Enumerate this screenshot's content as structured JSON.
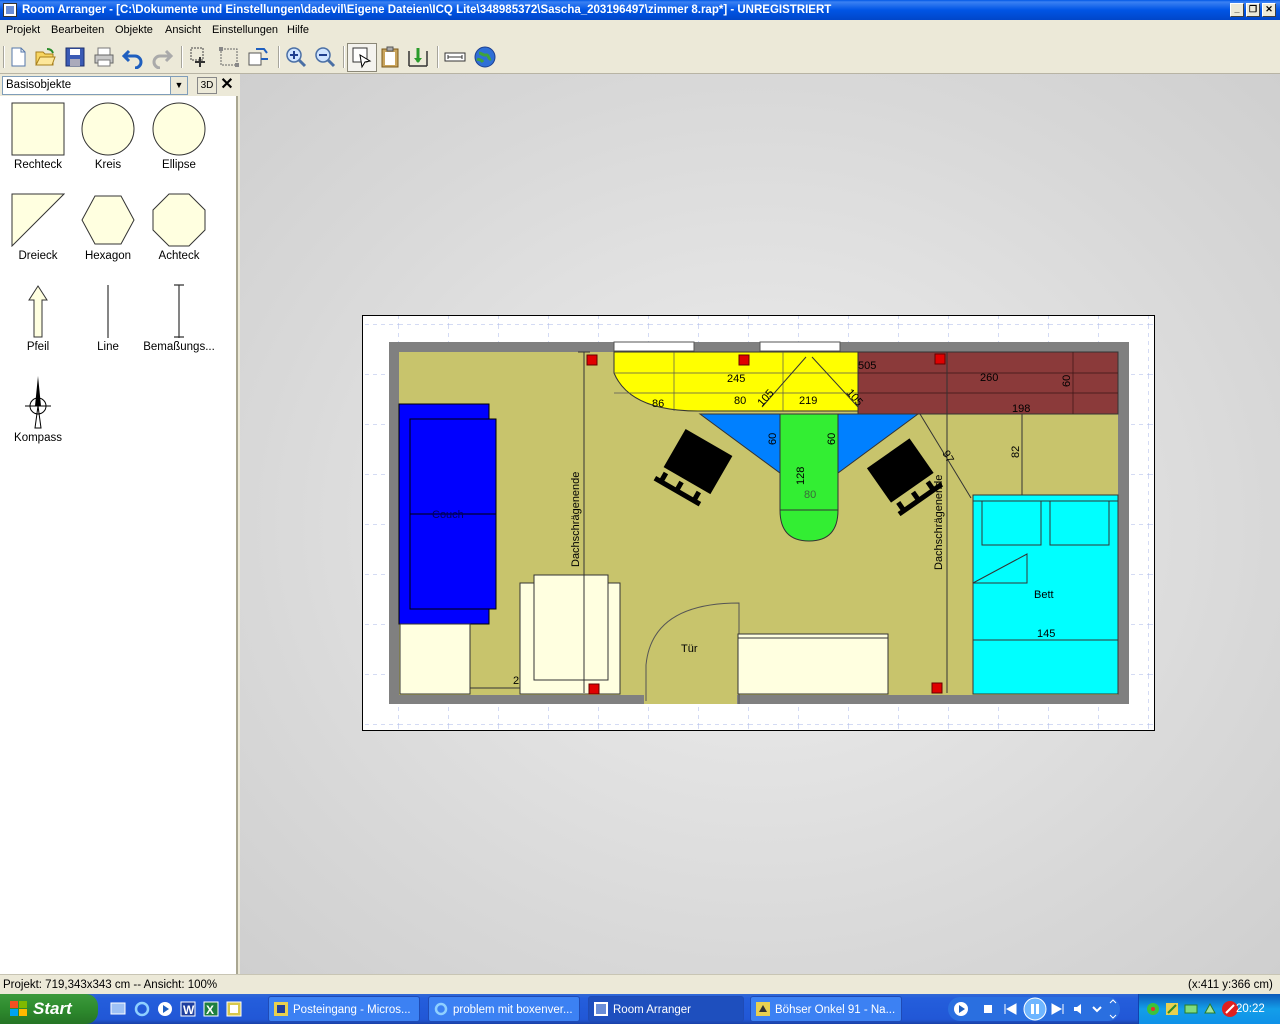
{
  "window": {
    "title": "Room Arranger - [C:\\Dokumente und Einstellungen\\dadevil\\Eigene Dateien\\ICQ Lite\\348985372\\Sascha_203196497\\zimmer 8.rap*] - UNREGISTRIERT"
  },
  "menu": [
    "Projekt",
    "Bearbeiten",
    "Objekte",
    "Ansicht",
    "Einstellungen",
    "Hilfe"
  ],
  "toolbar": {
    "icons": [
      "new-icon",
      "open-icon",
      "save-icon",
      "print-icon",
      "undo-icon",
      "redo-icon",
      "move-icon",
      "resize-icon",
      "rotate-icon",
      "zoom-in-icon",
      "zoom-out-icon",
      "select-icon",
      "clipboard-icon",
      "walls-icon",
      "dimension-icon",
      "globe-icon"
    ]
  },
  "panel": {
    "combo_value": "Basisobjekte",
    "btn_3d": "3D",
    "close": "✕",
    "shapes": [
      {
        "label": "Rechteck",
        "icon": "rectangle-icon"
      },
      {
        "label": "Kreis",
        "icon": "circle-icon"
      },
      {
        "label": "Ellipse",
        "icon": "ellipse-icon"
      },
      {
        "label": "Dreieck",
        "icon": "triangle-icon"
      },
      {
        "label": "Hexagon",
        "icon": "hexagon-icon"
      },
      {
        "label": "Achteck",
        "icon": "octagon-icon"
      },
      {
        "label": "Pfeil",
        "icon": "arrow-icon"
      },
      {
        "label": "Line",
        "icon": "line-icon"
      },
      {
        "label": "Bemaßungs...",
        "icon": "dimension-line-icon"
      },
      {
        "label": "Kompass",
        "icon": "compass-icon"
      }
    ]
  },
  "plan": {
    "labels": {
      "d245": "245",
      "d86": "86",
      "d80a": "80",
      "d105a": "105",
      "d219": "219",
      "d105b": "105",
      "d80b": "80",
      "d505": "505",
      "d260": "260",
      "d60a": "60",
      "d198": "198",
      "d82": "82",
      "d97": "97",
      "d60b": "60",
      "d60c": "60",
      "d128": "128",
      "d80c": "80",
      "couch": "Couch",
      "dach1": "Dachschrägenende",
      "dach2": "Dachschrägenende",
      "tuer": "Tür",
      "bett": "Bett",
      "d145": "145",
      "d2": "2"
    },
    "colors": {
      "floor": "#C8C46C",
      "wall": "#808080",
      "couch": "#0000FF",
      "shelf_yellow": "#FFFF00",
      "shelf_brown": "#8B3A3A",
      "desk_blue": "#0080FF",
      "desk_green": "#33EE33",
      "bed": "#00FFFF",
      "furniture_cream": "#FFFFE0",
      "marker": "#E00000"
    }
  },
  "status": {
    "left": "Projekt: 719,343x343 cm -- Ansicht: 100%",
    "right": "(x:411 y:366 cm)"
  },
  "taskbar": {
    "start": "Start",
    "tasks": [
      "Posteingang - Micros...",
      "problem mit boxenver...",
      "Room Arranger",
      "Böhser Onkel 91 - Na..."
    ],
    "clock": "20:22"
  }
}
